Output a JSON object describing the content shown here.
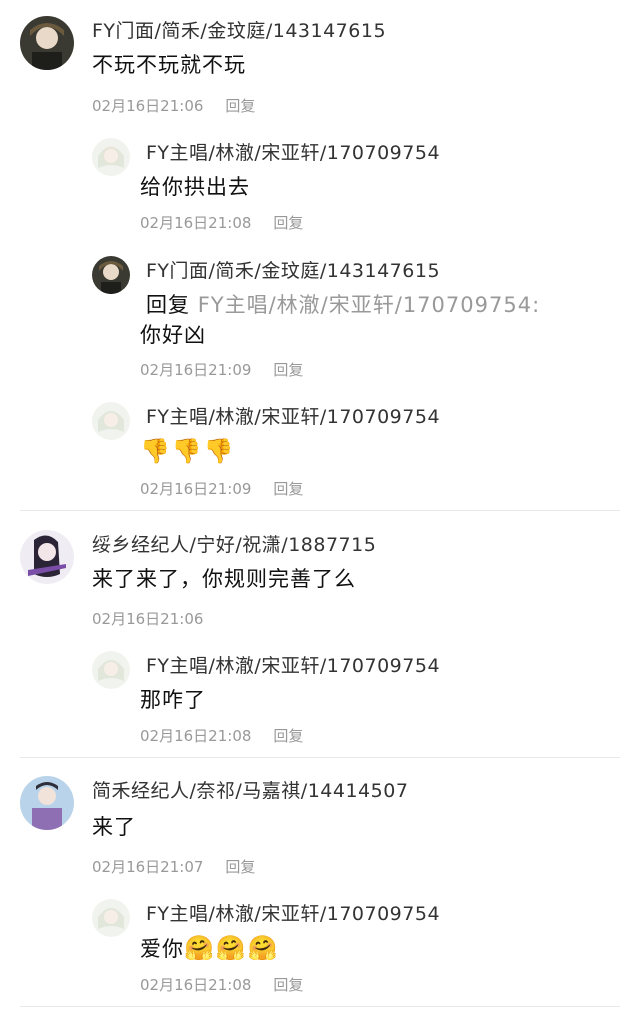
{
  "comments": [
    {
      "user": "FY门面/简禾/金玟庭/143147615",
      "text": "不玩不玩就不玩",
      "time": "02月16日21:06",
      "reply": "回复",
      "replies": [
        {
          "user": "FY主唱/林澈/宋亚轩/170709754",
          "text": "给你拱出去",
          "time": "02月16日21:08",
          "reply": "回复"
        },
        {
          "user": "FY门面/简禾/金玟庭/143147615",
          "prefix": "回复",
          "mention": "FY主唱/林澈/宋亚轩/170709754:",
          "text": "你好凶",
          "time": "02月16日21:09",
          "reply": "回复"
        },
        {
          "user": "FY主唱/林澈/宋亚轩/170709754",
          "emoji": "👎👎👎",
          "time": "02月16日21:09",
          "reply": "回复"
        }
      ]
    },
    {
      "user": "绥乡经纪人/宁好/祝潇/1887715",
      "text": "来了来了，你规则完善了么",
      "time": "02月16日21:06",
      "replies": [
        {
          "user": "FY主唱/林澈/宋亚轩/170709754",
          "text": "那咋了",
          "time": "02月16日21:08",
          "reply": "回复"
        }
      ]
    },
    {
      "user": "简禾经纪人/奈祁/马嘉祺/14414507",
      "text": "来了",
      "time": "02月16日21:07",
      "reply": "回复",
      "replies": [
        {
          "user": "FY主唱/林澈/宋亚轩/170709754",
          "text": "爱你",
          "emoji": "🤗🤗🤗",
          "time": "02月16日21:08",
          "reply": "回复"
        }
      ]
    }
  ],
  "colors": {
    "text": "#111111",
    "username": "#333333",
    "meta": "#999999",
    "divider": "#e8e8e8"
  }
}
